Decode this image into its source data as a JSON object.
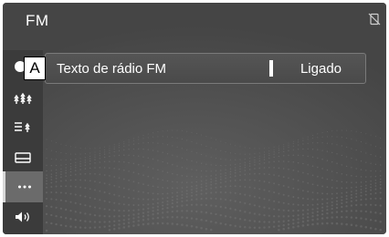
{
  "header": {
    "title": "FM",
    "status_icon": "phone-off-icon"
  },
  "sidebar": {
    "items": [
      {
        "icon": "station-list-icon",
        "selected": false
      },
      {
        "icon": "preset-list-icon",
        "selected": false
      },
      {
        "icon": "display-icon",
        "selected": false
      },
      {
        "icon": "more-options-icon",
        "selected": true
      },
      {
        "icon": "speaker-icon",
        "selected": false
      }
    ]
  },
  "settings": {
    "rows": [
      {
        "label": "Texto de rádio FM",
        "value": "Ligado"
      }
    ]
  },
  "callout": {
    "label": "A"
  },
  "colors": {
    "background": "#4a4a4a",
    "sidebar": "#3b3b3b",
    "selected": "#6b6b6b",
    "text": "#ffffff"
  }
}
